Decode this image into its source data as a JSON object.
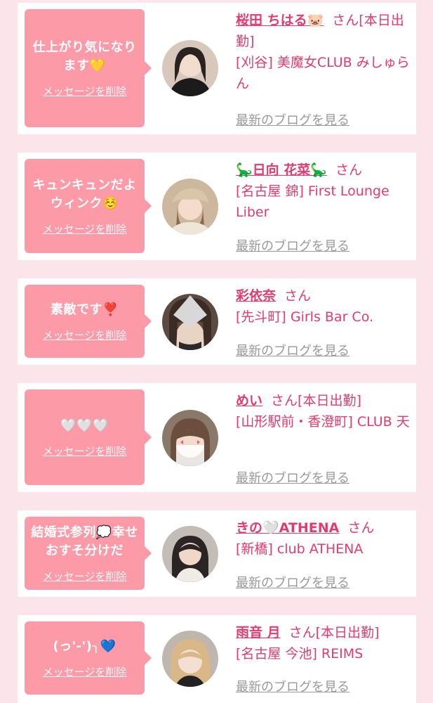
{
  "delete_label": "メッセージを削除",
  "blog_label": "最新のブログを見る",
  "san_label": "さん",
  "entries": [
    {
      "message": "仕上がり気になります💛",
      "name": "桜田 ちはる🐷",
      "suffix": "[本日出勤]",
      "shop": "[刈谷] 美魔女CLUB みしゅらん"
    },
    {
      "message": "キュンキュンだよウィンク☺️",
      "name": "🦕日向 花菜🦕",
      "suffix": "",
      "shop": "[名古屋 錦] First Lounge Liber"
    },
    {
      "message": "素敵です❣️",
      "name": "彩依奈",
      "suffix": "",
      "shop": "[先斗町] Girls Bar Co."
    },
    {
      "message": "🤍🤍🤍",
      "name": "めい",
      "suffix": "[本日出勤]",
      "shop": "[山形駅前・香澄町] CLUB 天"
    },
    {
      "message": "結婚式参列💭幸せおすそ分けだ",
      "name": "きの🤍ATHENA",
      "suffix": "",
      "shop": "[新橋] club ATHENA"
    },
    {
      "message": "(っ'-')╮💙",
      "name": "雨音 月",
      "suffix": "[本日出勤]",
      "shop": "[名古屋 今池] REIMS"
    }
  ]
}
